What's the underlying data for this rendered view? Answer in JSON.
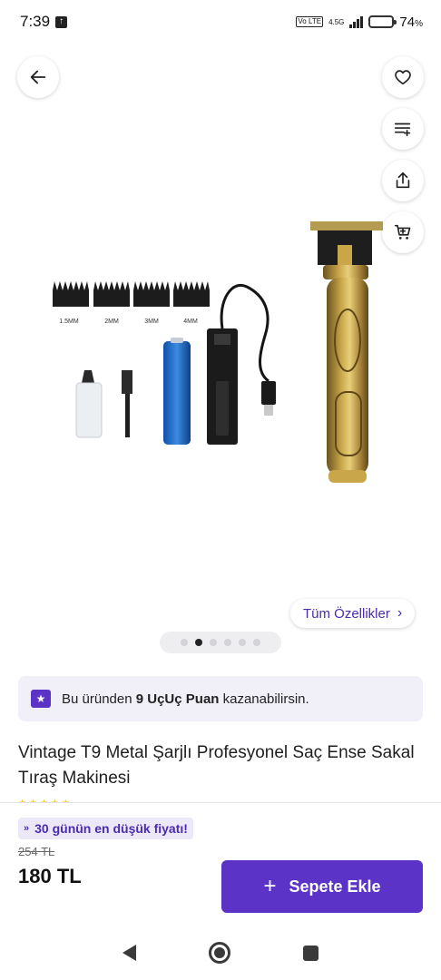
{
  "status_bar": {
    "time": "7:39",
    "network": "4.5G",
    "volte": "Vo LTE",
    "battery_percent": "74",
    "battery_unit": "%",
    "battery_level": 0.74,
    "battery_color": "#f0a500"
  },
  "actions": {
    "back_icon": "arrow-left-icon",
    "favorite_icon": "heart-icon",
    "add_to_list_icon": "list-add-icon",
    "share_icon": "share-icon",
    "cart_icon": "cart-icon"
  },
  "gallery": {
    "comb_labels": [
      "1.5MM",
      "2MM",
      "3MM",
      "4MM"
    ],
    "all_features_label": "Tüm Özellikler",
    "page_count": 6,
    "active_page": 2
  },
  "points_banner": {
    "text_before": "Bu üründen",
    "points": "9 UçUç Puan",
    "text_after": "kazanabilirsin."
  },
  "product": {
    "title": "Vintage T9 Metal Şarjlı Profesyonel Saç Ense Sakal Tıraş Makinesi",
    "rating_stars": 5
  },
  "bottom_bar": {
    "low_price_badge": "30 günün en düşük fiyatı!",
    "old_price": "254 TL",
    "price": "180 TL",
    "add_to_cart_label": "Sepete Ekle"
  },
  "colors": {
    "brand": "#5b34c7",
    "brand_text": "#4b2bb0",
    "banner_bg": "#f1f0f8"
  }
}
